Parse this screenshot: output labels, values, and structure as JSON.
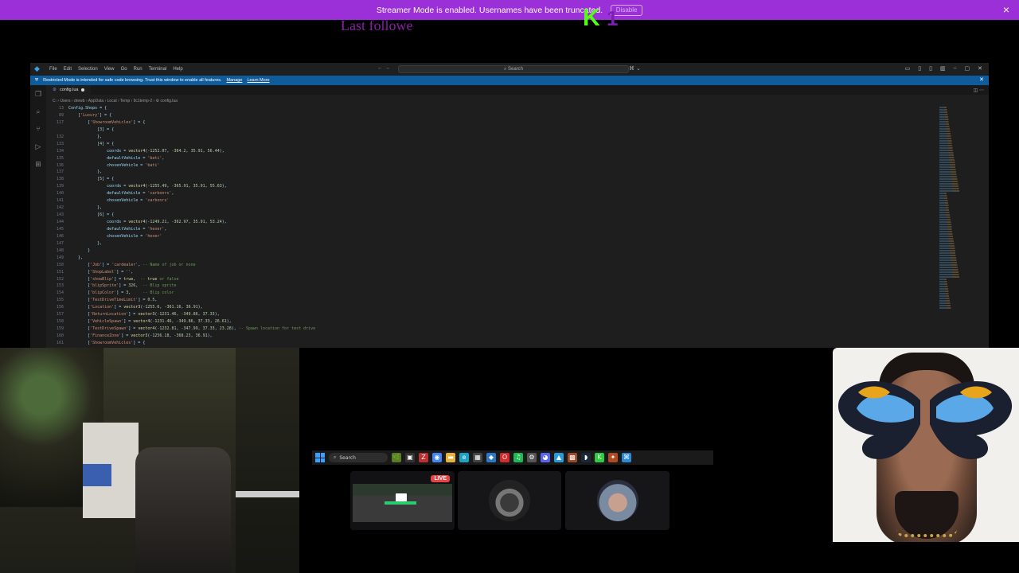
{
  "banner": {
    "text": "Streamer Mode is enabled. Usernames have been truncated.",
    "disable_label": "Disable",
    "close_icon": "×",
    "color": "#9b30d9"
  },
  "overlay": {
    "kick_letter": "K",
    "kick_badge": "1",
    "last_follower": "Last followe"
  },
  "vscode": {
    "menu": [
      "File",
      "Edit",
      "Selection",
      "View",
      "Go",
      "Run",
      "Terminal",
      "Help"
    ],
    "nav": "← →",
    "search_label": "Search",
    "copilot_icon": "⌘ ⌄",
    "window_controls": [
      "▭",
      "▯",
      "▯",
      "▥",
      "–",
      "▢",
      "✕"
    ],
    "restricted_text": "Restricted Mode is intended for safe code browsing. Trust this window to enable all features.",
    "restricted_manage": "Manage",
    "restricted_learn": "Learn More",
    "tab_label": "config.lua",
    "tab_right_icons": "◫ ⋯",
    "breadcrumb": "C: › Users › drewb › AppData › Local › Temp › 9c1temp-2 › ⚙ config.lua",
    "sticky": [
      {
        "ln": "13",
        "code": "Config.Shops = {"
      },
      {
        "ln": "89",
        "code": "    ['Luxury'] = {"
      },
      {
        "ln": "117",
        "code": "        ['ShowroomVehicles'] = {"
      },
      {
        "ln": "",
        "code": "            [3] = {"
      }
    ],
    "lines": [
      {
        "ln": "132",
        "code": "            },"
      },
      {
        "ln": "133",
        "code": "            [4] = {"
      },
      {
        "ln": "134",
        "code": "                coords = vector4(-1252.07, -364.2, 35.91, 56.44),"
      },
      {
        "ln": "135",
        "code": "                defaultVehicle = 'bati',"
      },
      {
        "ln": "136",
        "code": "                chosenVehicle = 'bati'"
      },
      {
        "ln": "137",
        "code": "            },"
      },
      {
        "ln": "138",
        "code": "            [5] = {"
      },
      {
        "ln": "139",
        "code": "                coords = vector4(-1255.49, -365.91, 35.91, 55.63),"
      },
      {
        "ln": "140",
        "code": "                defaultVehicle = 'carbonrs',"
      },
      {
        "ln": "141",
        "code": "                chosenVehicle = 'carbonrs'"
      },
      {
        "ln": "142",
        "code": "            },"
      },
      {
        "ln": "143",
        "code": "            [6] = {"
      },
      {
        "ln": "144",
        "code": "                coords = vector4(-1249.21, -362.97, 35.91, 53.24),"
      },
      {
        "ln": "145",
        "code": "                defaultVehicle = 'hexer',"
      },
      {
        "ln": "146",
        "code": "                chosenVehicle = 'hexer'"
      },
      {
        "ln": "147",
        "code": "            },"
      },
      {
        "ln": "148",
        "code": "        }"
      },
      {
        "ln": "149",
        "code": "    },"
      },
      {
        "ln": "150",
        "code": "        ['Job'] = 'cardealer', -- Name of job or none"
      },
      {
        "ln": "151",
        "code": "        ['ShopLabel'] = '',"
      },
      {
        "ln": "152",
        "code": "        ['showBlip'] = true,  -- true or false"
      },
      {
        "ln": "153",
        "code": "        ['blipSprite'] = 326,  -- Blip sprite"
      },
      {
        "ln": "154",
        "code": "        ['blipColor'] = 3,     -- Blip color"
      },
      {
        "ln": "155",
        "code": "        ['TestDriveTimeLimit'] = 0.5,"
      },
      {
        "ln": "156",
        "code": "        ['Location'] = vector3(-1255.6, -361.16, 36.91),"
      },
      {
        "ln": "157",
        "code": "        ['ReturnLocation'] = vector3(-1231.46, -349.86, 37.33),"
      },
      {
        "ln": "158",
        "code": "        ['VehicleSpawn'] = vector4(-1231.46, -349.86, 37.33, 26.61),"
      },
      {
        "ln": "159",
        "code": "        ['TestDriveSpawn'] = vector4(-1232.81, -347.99, 37.33, 23.28), -- Spawn location for test drive"
      },
      {
        "ln": "160",
        "code": "        ['FinanceZone'] = vector3(-1256.18, -368.23, 36.91),"
      },
      {
        "ln": "161",
        "code": "        ['ShowroomVehicles'] = {"
      }
    ],
    "activity_icons": [
      "files-icon",
      "search-icon",
      "source-control-icon",
      "debug-icon",
      "extensions-icon"
    ]
  },
  "taskbar": {
    "search_label": "Search",
    "apps": [
      {
        "name": "widgets-icon",
        "glyph": "🌿",
        "color": "#5a7a2a"
      },
      {
        "name": "task-view-icon",
        "glyph": "▣",
        "color": "#333"
      },
      {
        "name": "filezilla-icon",
        "glyph": "Z",
        "color": "#bf2f2f"
      },
      {
        "name": "chrome-icon",
        "glyph": "◉",
        "color": "#4285f4"
      },
      {
        "name": "explorer-icon",
        "glyph": "▬",
        "color": "#e8b339"
      },
      {
        "name": "edge-icon",
        "glyph": "e",
        "color": "#1aa3c8"
      },
      {
        "name": "store-icon",
        "glyph": "▦",
        "color": "#444"
      },
      {
        "name": "vpn-icon",
        "glyph": "◆",
        "color": "#2a78c8"
      },
      {
        "name": "opera-icon",
        "glyph": "O",
        "color": "#d62a2a"
      },
      {
        "name": "spotify-icon",
        "glyph": "♫",
        "color": "#1db954"
      },
      {
        "name": "settings-icon",
        "glyph": "⚙",
        "color": "#555"
      },
      {
        "name": "discord-icon",
        "glyph": "◕",
        "color": "#5865f2"
      },
      {
        "name": "photos-icon",
        "glyph": "▲",
        "color": "#2a9ad8"
      },
      {
        "name": "game-icon",
        "glyph": "▩",
        "color": "#a04a2a"
      },
      {
        "name": "steam-icon",
        "glyph": "◗",
        "color": "#1b2838"
      },
      {
        "name": "kick-icon",
        "glyph": "K",
        "color": "#2ecc40"
      },
      {
        "name": "app-icon",
        "glyph": "✦",
        "color": "#b04a20"
      },
      {
        "name": "vscode-icon",
        "glyph": "⌘",
        "color": "#2a8ad8"
      }
    ]
  },
  "tiles": {
    "live_label": "LIVE"
  }
}
